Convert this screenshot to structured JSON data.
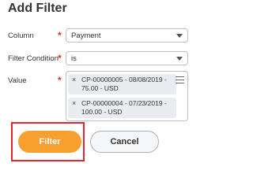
{
  "dialog": {
    "title": "Add Filter"
  },
  "fields": {
    "column": {
      "label": "Column",
      "required_marker": "*",
      "value": "Payment"
    },
    "filter_condition": {
      "label": "Filter Condition",
      "required_marker": "*",
      "value": "is"
    },
    "value": {
      "label": "Value",
      "required_marker": "*",
      "selected_items": [
        {
          "remove_glyph": "×",
          "text": "CP-00000005 - 08/08/2019 - 75.00 - USD"
        },
        {
          "remove_glyph": "×",
          "text": "CP-00000004 - 07/23/2019 - 100.00 - USD"
        }
      ],
      "list_icon": "list-icon"
    }
  },
  "buttons": {
    "filter": "Filter",
    "cancel": "Cancel"
  },
  "colors": {
    "required": "#e12f2f",
    "primary_button": "#f7a030",
    "highlight_box": "#e3262f",
    "pill_background": "#e9edf1"
  }
}
